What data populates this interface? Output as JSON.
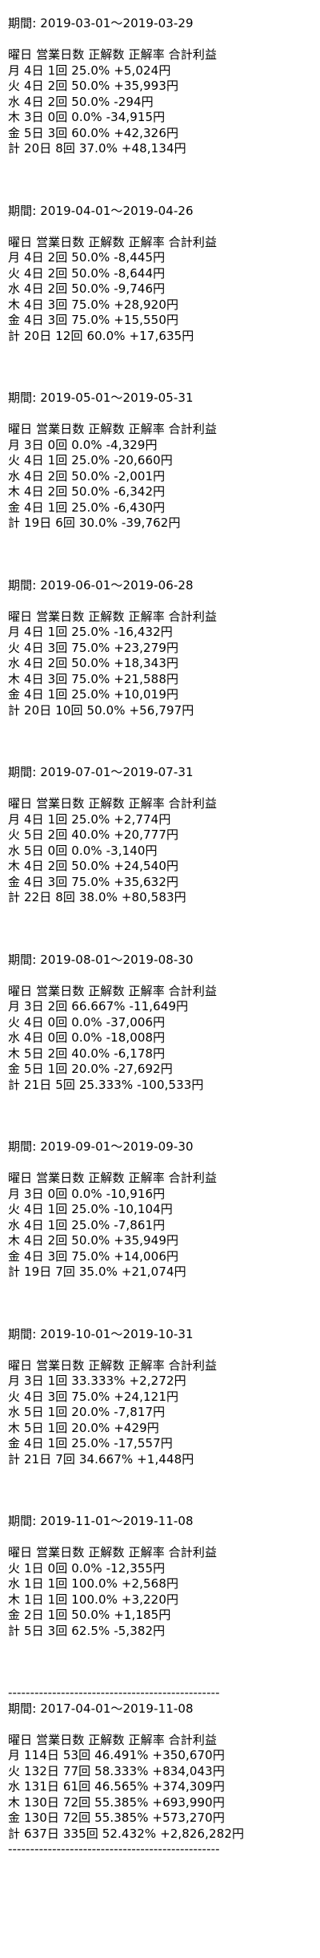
{
  "header_label": "曜日 営業日数 正解数 正解率 合計利益",
  "periods": [
    {
      "period": "期間: 2019-03-01～2019-03-29",
      "rows": [
        "月 4日 1回 25.0% +5,024円",
        "火 4日 2回 50.0% +35,993円",
        "水 4日 2回 50.0% -294円",
        "木 3日 0回 0.0% -34,915円",
        "金 5日 3回 60.0% +42,326円",
        "計 20日 8回 37.0% +48,134円"
      ]
    },
    {
      "period": "期間: 2019-04-01～2019-04-26",
      "rows": [
        "月 4日 2回 50.0% -8,445円",
        "火 4日 2回 50.0% -8,644円",
        "水 4日 2回 50.0% -9,746円",
        "木 4日 3回 75.0% +28,920円",
        "金 4日 3回 75.0% +15,550円",
        "計 20日 12回 60.0% +17,635円"
      ]
    },
    {
      "period": "期間: 2019-05-01～2019-05-31",
      "rows": [
        "月 3日 0回 0.0% -4,329円",
        "火 4日 1回 25.0% -20,660円",
        "水 4日 2回 50.0% -2,001円",
        "木 4日 2回 50.0% -6,342円",
        "金 4日 1回 25.0% -6,430円",
        "計 19日 6回 30.0% -39,762円"
      ]
    },
    {
      "period": "期間: 2019-06-01～2019-06-28",
      "rows": [
        "月 4日 1回 25.0% -16,432円",
        "火 4日 3回 75.0% +23,279円",
        "水 4日 2回 50.0% +18,343円",
        "木 4日 3回 75.0% +21,588円",
        "金 4日 1回 25.0% +10,019円",
        "計 20日 10回 50.0% +56,797円"
      ]
    },
    {
      "period": "期間: 2019-07-01～2019-07-31",
      "rows": [
        "月 4日 1回 25.0% +2,774円",
        "火 5日 2回 40.0% +20,777円",
        "水 5日 0回 0.0% -3,140円",
        "木 4日 2回 50.0% +24,540円",
        "金 4日 3回 75.0% +35,632円",
        "計 22日 8回 38.0% +80,583円"
      ]
    },
    {
      "period": "期間: 2019-08-01～2019-08-30",
      "rows": [
        "月 3日 2回 66.667% -11,649円",
        "火 4日 0回 0.0% -37,006円",
        "水 4日 0回 0.0% -18,008円",
        "木 5日 2回 40.0% -6,178円",
        "金 5日 1回 20.0% -27,692円",
        "計 21日 5回 25.333% -100,533円"
      ]
    },
    {
      "period": "期間: 2019-09-01～2019-09-30",
      "rows": [
        "月 3日 0回 0.0% -10,916円",
        "火 4日 1回 25.0% -10,104円",
        "水 4日 1回 25.0% -7,861円",
        "木 4日 2回 50.0% +35,949円",
        "金 4日 3回 75.0% +14,006円",
        "計 19日 7回 35.0% +21,074円"
      ]
    },
    {
      "period": "期間: 2019-10-01～2019-10-31",
      "rows": [
        "月 3日 1回 33.333% +2,272円",
        "火 4日 3回 75.0% +24,121円",
        "水 5日 1回 20.0% -7,817円",
        "木 5日 1回 20.0% +429円",
        "金 4日 1回 25.0% -17,557円",
        "計 21日 7回 34.667% +1,448円"
      ]
    },
    {
      "period": "期間: 2019-11-01～2019-11-08",
      "rows": [
        "火 1日 0回 0.0% -12,355円",
        "水 1日 1回 100.0% +2,568円",
        "木 1日 1回 100.0% +3,220円",
        "金 2日 1回 50.0% +1,185円",
        "計 5日 3回 62.5% -5,382円"
      ]
    }
  ],
  "separator": "------------------------------------------------",
  "summary": {
    "period": "期間: 2017-04-01～2019-11-08",
    "rows": [
      "月 114日 53回 46.491% +350,670円",
      "火 132日 77回 58.333% +834,043円",
      "水 131日 61回 46.565% +374,309円",
      "木 130日 72回 55.385% +693,990円",
      "金 130日 72回 55.385% +573,270円",
      "計 637日 335回 52.432% +2,826,282円"
    ]
  }
}
